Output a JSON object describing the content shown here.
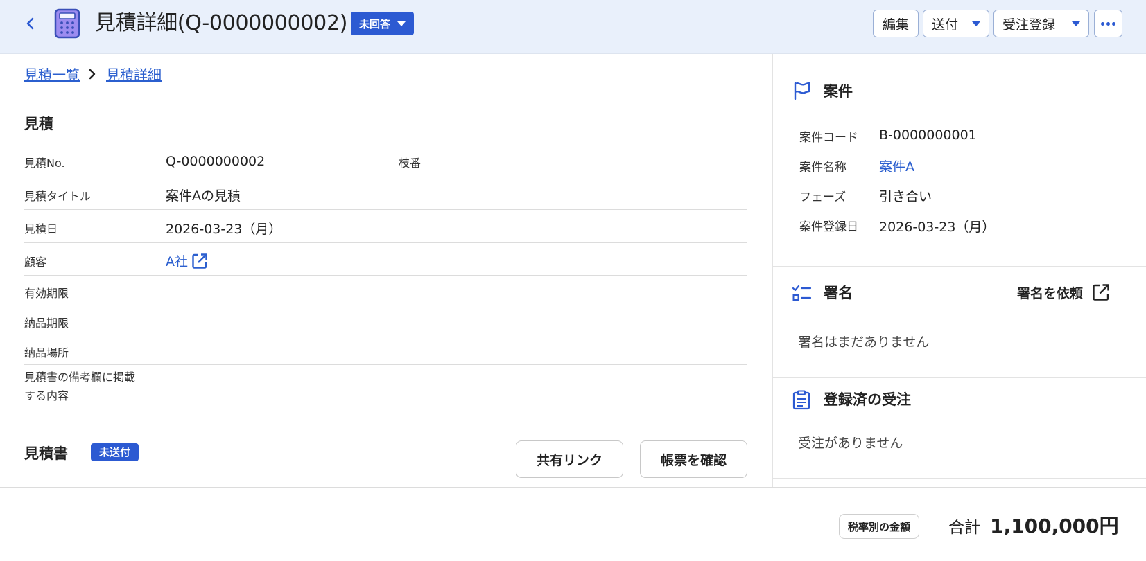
{
  "header": {
    "title": "見積詳細(Q-0000000002)",
    "status": "未回答",
    "buttons": {
      "edit": "編集",
      "send": "送付",
      "order": "受注登録"
    },
    "back_icon": "chevron-left-icon",
    "app_icon": "calculator-icon",
    "colors": {
      "header_bg": "#e9f0fb",
      "accent": "#2c5ad2"
    }
  },
  "breadcrumb": {
    "list": "見積一覧",
    "detail": "見積詳細"
  },
  "quote": {
    "section_title": "見積",
    "fields": {
      "quote_no": {
        "label": "見積No.",
        "value": "Q-0000000002"
      },
      "branch": {
        "label": "枝番",
        "value": ""
      },
      "title": {
        "label": "見積タイトル",
        "value": "案件Aの見積"
      },
      "date": {
        "label": "見積日",
        "value": "2026-03-23（月）"
      },
      "customer": {
        "label": "顧客",
        "value": "A社"
      },
      "valid_until": {
        "label": "有効期限",
        "value": ""
      },
      "delivery_deadline": {
        "label": "納品期限",
        "value": ""
      },
      "delivery_place": {
        "label": "納品場所",
        "value": ""
      },
      "remarks": {
        "label_line1": "見積書の備考欄に掲載",
        "label_line2": "する内容",
        "value": ""
      }
    }
  },
  "document": {
    "title": "見積書",
    "status": "未送付",
    "share_link": "共有リンク",
    "check_form": "帳票を確認"
  },
  "project": {
    "title": "案件",
    "icon": "flag-icon",
    "code_label": "案件コード",
    "code": "B-0000000001",
    "name_label": "案件名称",
    "name": "案件A",
    "phase_label": "フェーズ",
    "phase": "引き合い",
    "registered_label": "案件登録日",
    "registered": "2026-03-23（月）"
  },
  "signature": {
    "title": "署名",
    "icon": "checklist-icon",
    "request": "署名を依頼",
    "empty": "署名はまだありません"
  },
  "orders": {
    "title": "登録済の受注",
    "icon": "clipboard-icon",
    "empty": "受注がありません"
  },
  "footer": {
    "tax_button": "税率別の金額",
    "total_label": "合計",
    "total_value": "1,100,000円"
  }
}
